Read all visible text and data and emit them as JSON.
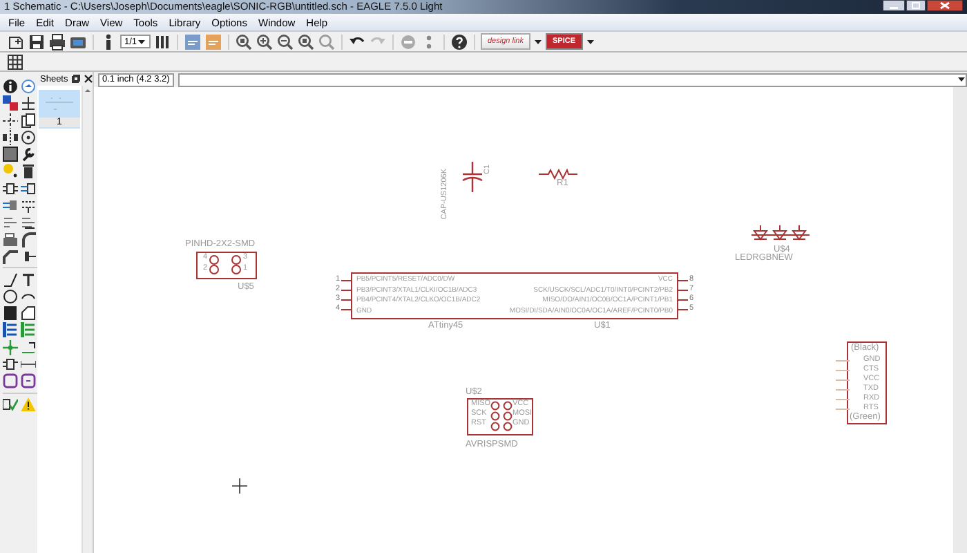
{
  "window": {
    "title": "1 Schematic - C:\\Users\\Joseph\\Documents\\eagle\\SONIC-RGB\\untitled.sch - EAGLE 7.5.0 Light"
  },
  "menu": [
    "File",
    "Edit",
    "Draw",
    "View",
    "Tools",
    "Library",
    "Options",
    "Window",
    "Help"
  ],
  "toolbar": {
    "sheet_select": "1/1",
    "link_buttons": [
      {
        "label": "design link"
      },
      {
        "label": "SPICE"
      }
    ]
  },
  "sheets_panel": {
    "title": "Sheets",
    "sheets": [
      {
        "label": "1",
        "selected": true
      }
    ]
  },
  "coordinates": "0.1 inch (4.2 3.2)",
  "schematic": {
    "parts": [
      {
        "kind": "capacitor",
        "name": "C1",
        "value": "CAP-US1206K"
      },
      {
        "kind": "resistor",
        "name": "R1"
      },
      {
        "kind": "led",
        "name": "U$4",
        "value": "LEDRGBNEW"
      },
      {
        "kind": "header",
        "value": "PINHD-2X2-SMD",
        "name": "U$5",
        "pins": [
          "4",
          "3",
          "2",
          "1"
        ]
      },
      {
        "kind": "ic",
        "value": "ATtiny45",
        "name": "U$1",
        "left_pins": [
          {
            "number": "1",
            "label": "PB5/PCINT5/RESET/ADC0/DW"
          },
          {
            "number": "2",
            "label": "PB3/PCINT3/XTAL1/CLKI/OC1B/ADC3"
          },
          {
            "number": "3",
            "label": "PB4/PCINT4/XTAL2/CLKO/OC1B/ADC2"
          },
          {
            "number": "4",
            "label": "GND"
          }
        ],
        "right_pins": [
          {
            "number": "8",
            "label": "VCC"
          },
          {
            "number": "7",
            "label": "SCK/USCK/SCL/ADC1/T0/INT0/PCINT2/PB2"
          },
          {
            "number": "6",
            "label": "MISO/DO/AIN1/OC0B/OC1A/PCINT1/PB1"
          },
          {
            "number": "5",
            "label": "MOSI/DI/SDA/AIN0/OC0A/OC1A/AREF/PCINT0/PB0"
          }
        ]
      },
      {
        "kind": "isp",
        "name": "U$2",
        "value": "AVRISPSMD",
        "left_pins": [
          "MISO",
          "SCK",
          "RST"
        ],
        "right_pins": [
          "VCC",
          "MOSI",
          "GND"
        ]
      },
      {
        "kind": "connector",
        "top_label": "(Black)",
        "bottom_label": "(Green)",
        "pins": [
          "GND",
          "CTS",
          "VCC",
          "TXD",
          "RXD",
          "RTS"
        ]
      }
    ]
  }
}
